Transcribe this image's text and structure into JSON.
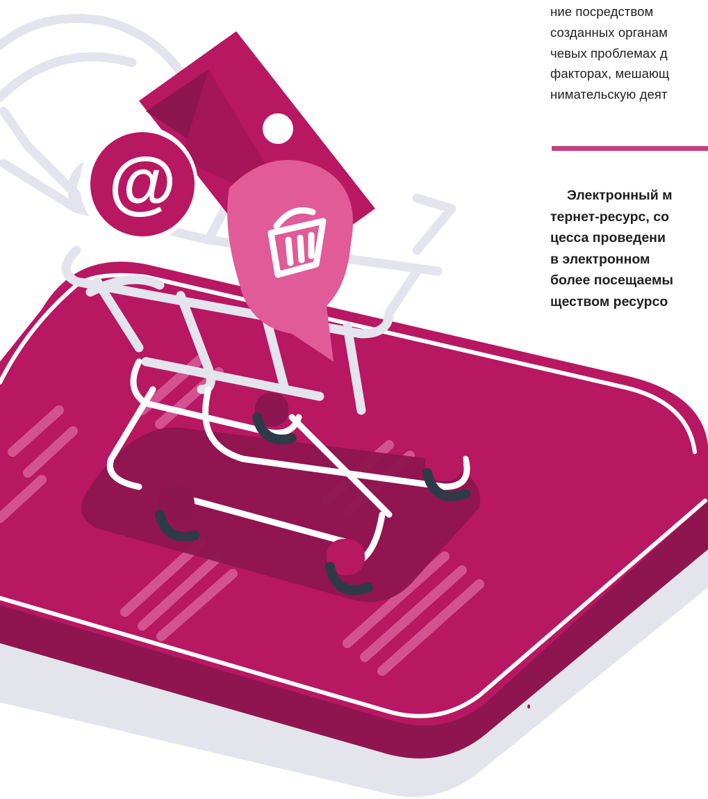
{
  "top_text": {
    "lines": [
      "ние   посредством",
      "созданных органам",
      "чевых проблемах д",
      "факторах, мешающ",
      "нимательскую деят"
    ]
  },
  "bottom_text": {
    "lines": [
      "Электронный м",
      "тернет-ресурс, со",
      "цесса  проведени",
      "в  электронном",
      "более посещаемы",
      "ществом ресурсо"
    ]
  },
  "illustration": {
    "icons": [
      "phone-icon",
      "shopping-cart-icon",
      "at-sign-icon",
      "image-card-icon",
      "chat-bubble-icon",
      "basket-icon"
    ],
    "colors": {
      "phone": "#b81762",
      "phone_dark": "#8d1550",
      "shadow": "#e2e2ea",
      "cart_line": "#ffffff",
      "cart_outline": "#e4e4ee",
      "bubble": "#e05b98",
      "wheel": "#2e3a48",
      "divider": "#c4407e"
    }
  }
}
